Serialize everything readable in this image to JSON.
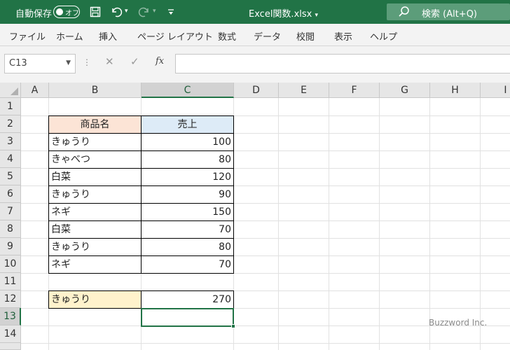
{
  "titlebar": {
    "autosave_label": "自動保存",
    "autosave_state": "オフ",
    "file_title": "Excel関数.xlsx",
    "search_label": "検索 (Alt+Q)"
  },
  "ribbon": {
    "tabs": [
      "ファイル",
      "ホーム",
      "挿入",
      "ページ レイアウト",
      "数式",
      "データ",
      "校閲",
      "表示",
      "ヘルプ"
    ]
  },
  "formula_bar": {
    "name_box": "C13",
    "fx_label": "fx",
    "formula": ""
  },
  "sheet": {
    "columns": [
      "A",
      "B",
      "C",
      "D",
      "E",
      "F",
      "G",
      "H",
      "I"
    ],
    "rows": [
      "1",
      "2",
      "3",
      "4",
      "5",
      "6",
      "7",
      "8",
      "9",
      "10",
      "11",
      "12",
      "13",
      "14"
    ],
    "selected_column": "C",
    "selected_row": "13",
    "table_header": {
      "product": "商品名",
      "sales": "売上"
    },
    "table_rows": [
      {
        "product": "きゅうり",
        "sales": "100"
      },
      {
        "product": "きゃべつ",
        "sales": "80"
      },
      {
        "product": "白菜",
        "sales": "120"
      },
      {
        "product": "きゅうり",
        "sales": "90"
      },
      {
        "product": "ネギ",
        "sales": "150"
      },
      {
        "product": "白菜",
        "sales": "70"
      },
      {
        "product": "きゅうり",
        "sales": "80"
      },
      {
        "product": "ネギ",
        "sales": "70"
      }
    ],
    "lookup": {
      "key": "きゅうり",
      "result": "270"
    }
  },
  "colors": {
    "accent": "#217346",
    "header_product_bg": "#fce4d6",
    "header_sales_bg": "#ddebf7",
    "lookup_key_bg": "#fff2cc"
  },
  "watermark": "Buzzword Inc."
}
